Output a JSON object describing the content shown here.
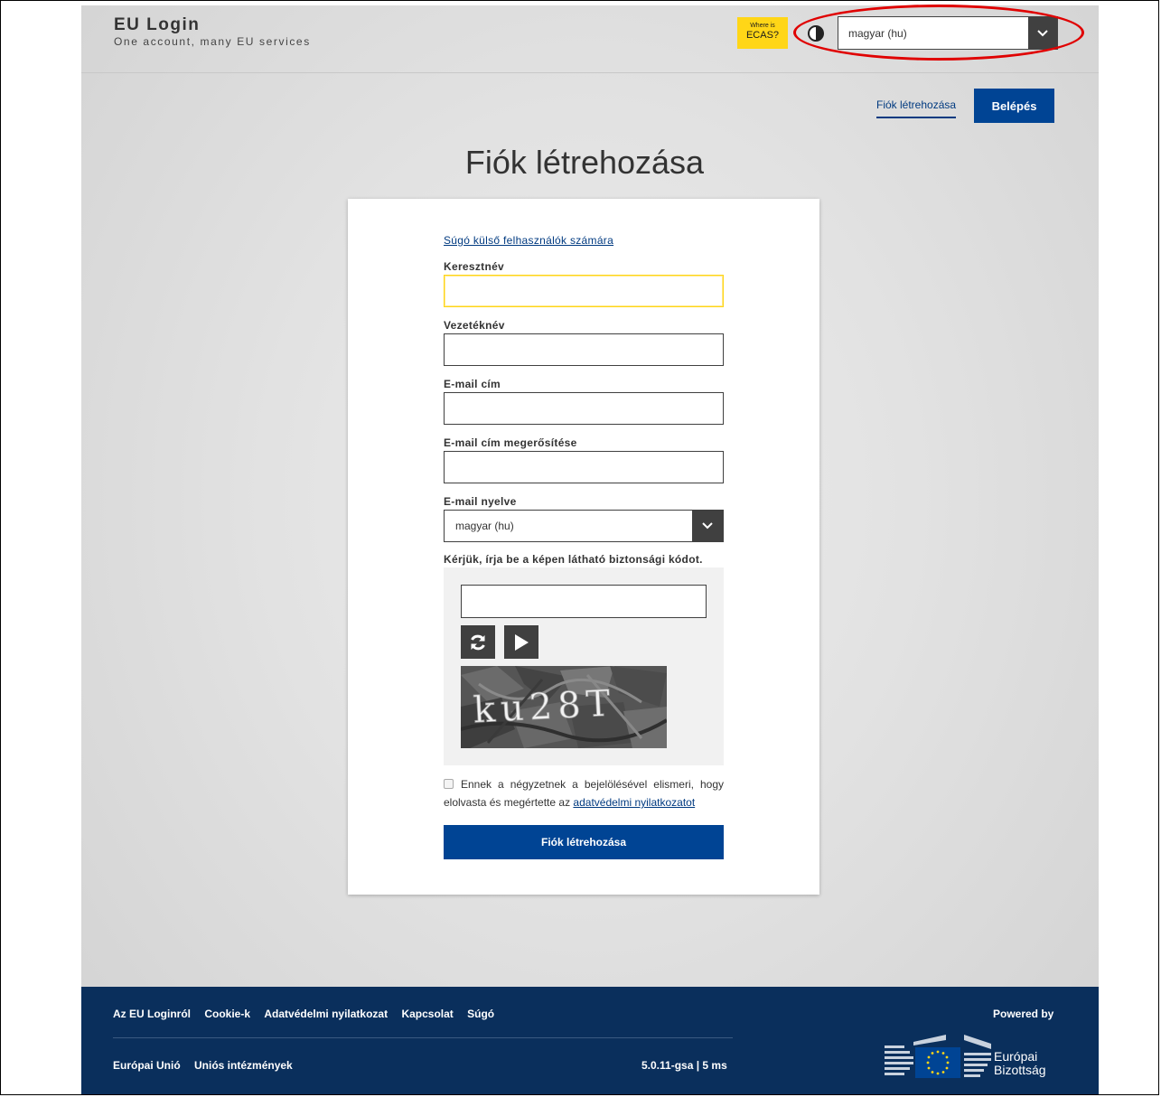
{
  "header": {
    "brand_title": "EU Login",
    "brand_subtitle": "One account, many EU services",
    "ecas_small": "Where is",
    "ecas_big": "ECAS?",
    "language_selected": "magyar (hu)"
  },
  "nav": {
    "create_account": "Fiók létrehozása",
    "login": "Belépés"
  },
  "page_title": "Fiók létrehozása",
  "form": {
    "help_link": "Súgó külső felhasználók számára",
    "first_name_label": "Keresztnév",
    "last_name_label": "Vezetéknév",
    "email_label": "E-mail cím",
    "email_confirm_label": "E-mail cím megerősítése",
    "email_language_label": "E-mail nyelve",
    "email_language_value": "magyar (hu)",
    "captcha_label": "Kérjük, írja be a képen látható biztonsági kódot.",
    "captcha_text": "ku28T",
    "consent_text": "Ennek a négyzetnek a bejelölésével elismeri, hogy elolvasta és megértette az",
    "consent_link": "adatvédelmi nyilatkozatot",
    "submit": "Fiók létrehozása"
  },
  "footer": {
    "links_top": [
      "Az EU Loginról",
      "Cookie-k",
      "Adatvédelmi nyilatkozat",
      "Kapcsolat",
      "Súgó"
    ],
    "links_bottom": [
      "Európai Unió",
      "Uniós intézmények"
    ],
    "version": "5.0.11-gsa | 5 ms",
    "powered_by": "Powered by",
    "ec_line1": "Európai",
    "ec_line2": "Bizottság"
  },
  "colors": {
    "primary": "#004494",
    "accent_yellow": "#ffd617",
    "footer_bg": "#0a2f5c",
    "annotation_red": "#e00000"
  }
}
